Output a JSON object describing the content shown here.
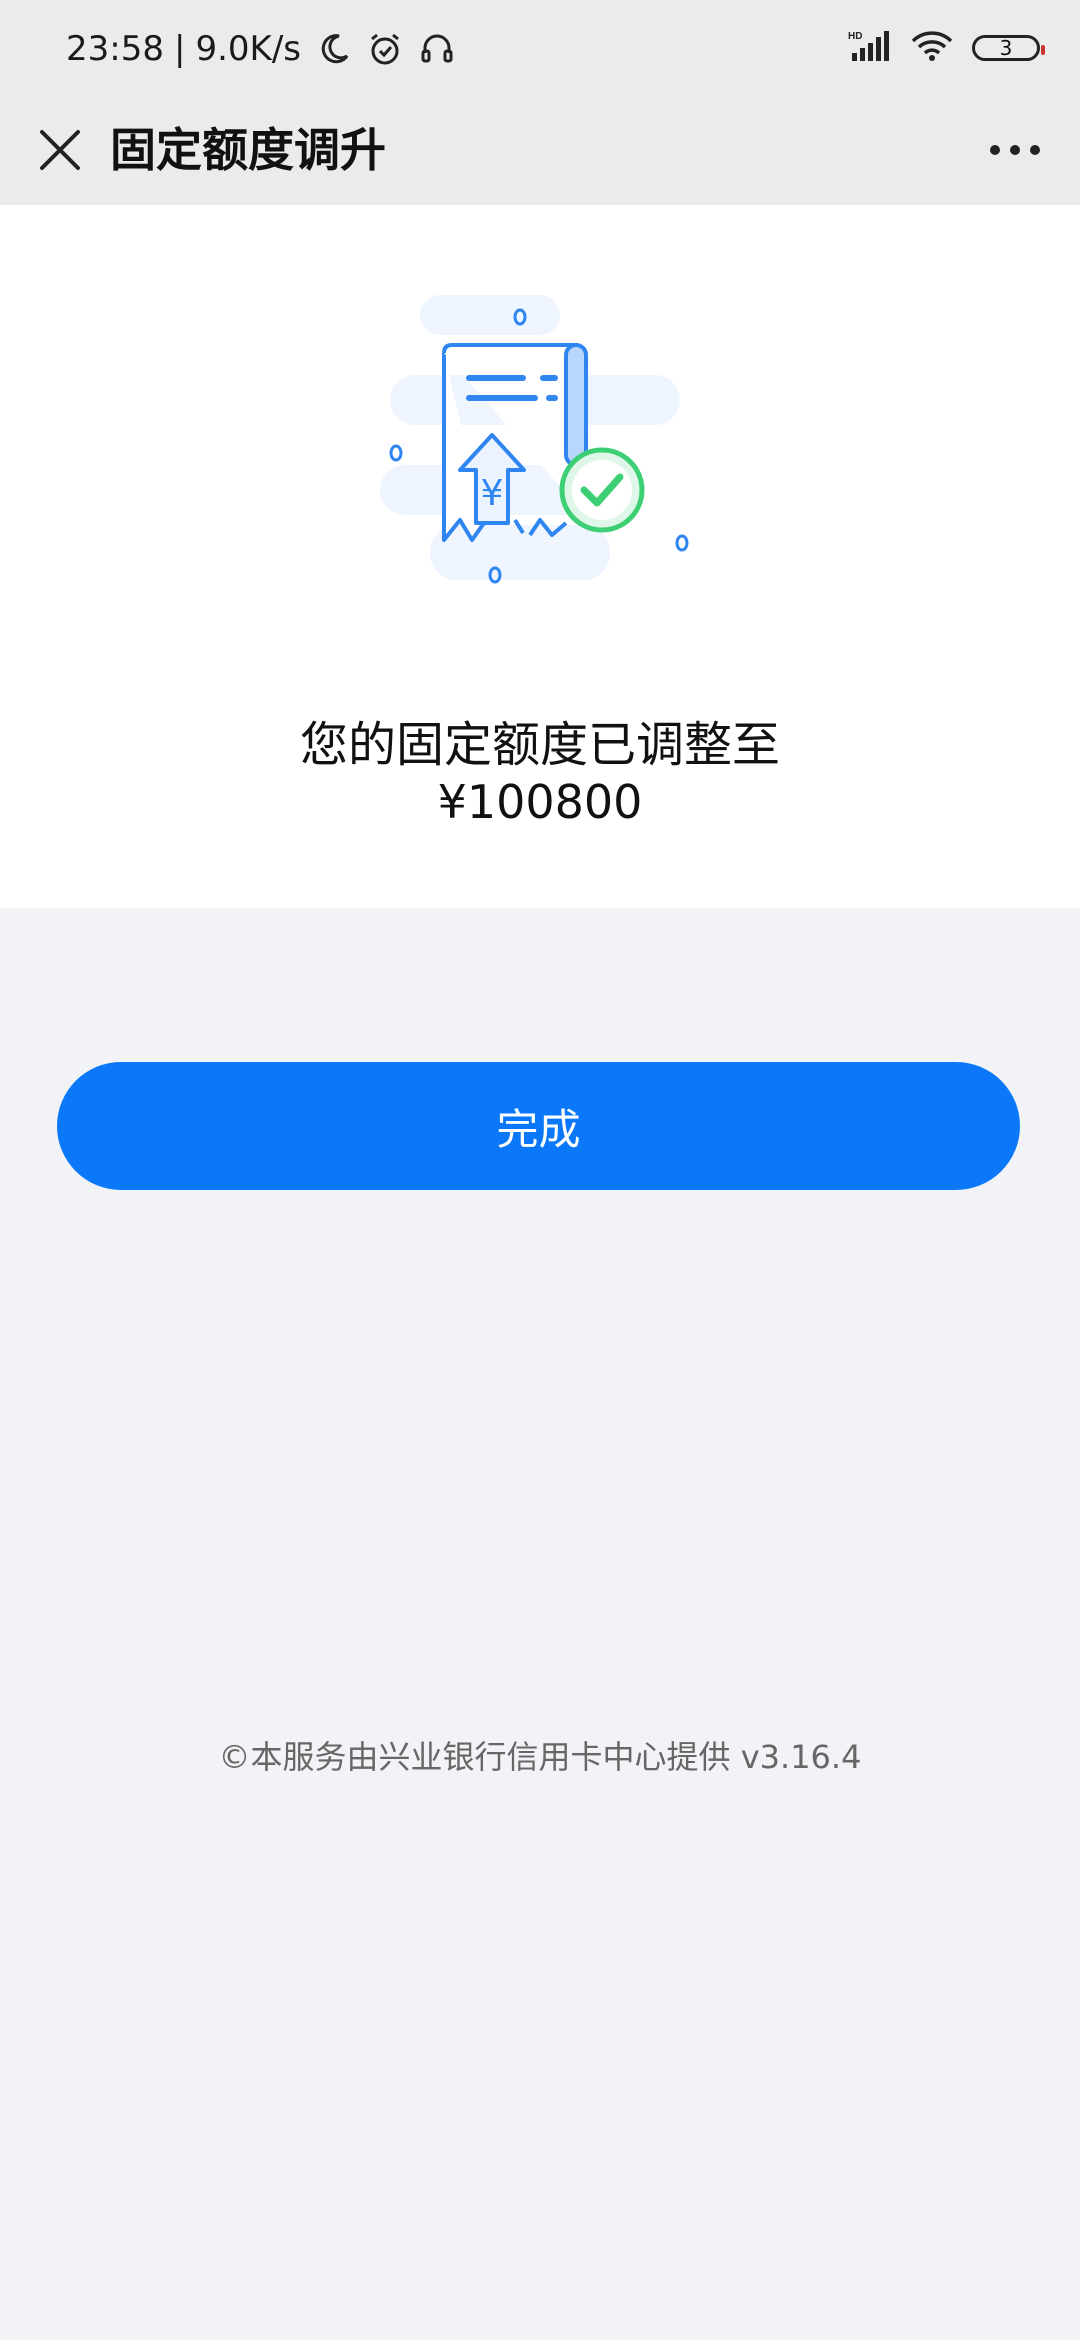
{
  "status_bar": {
    "time": "23:58",
    "network_speed": "9.0K/s",
    "left_icons": [
      "moon-icon",
      "alarm-icon",
      "headset-icon"
    ],
    "signal_label": "HD",
    "battery_level": "3"
  },
  "nav": {
    "title": "固定额度调升",
    "close_icon": "close-icon",
    "more_icon": "more-icon"
  },
  "result": {
    "message": "您的固定额度已调整至",
    "amount": "¥100800"
  },
  "actions": {
    "done_label": "完成"
  },
  "footer": {
    "text": "©本服务由兴业银行信用卡中心提供 v3.16.4"
  },
  "colors": {
    "primary": "#0a78f8",
    "success": "#3ccf74",
    "page_bg": "#f2f3f7",
    "header_bg": "#ebebeb"
  }
}
